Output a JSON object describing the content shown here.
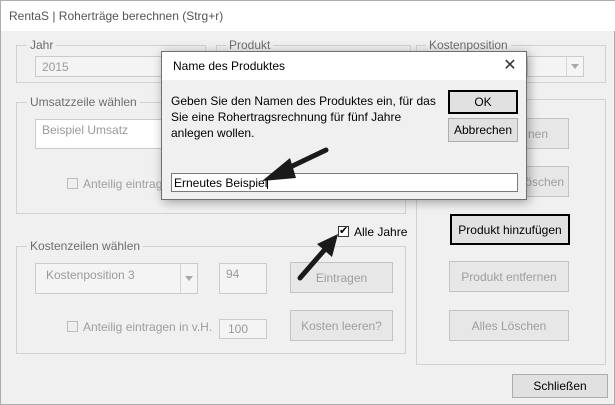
{
  "window": {
    "title": "RentaS | Roherträge berechnen (Strg+r)"
  },
  "jahr": {
    "legend": "Jahr",
    "value": "2015"
  },
  "produkt": {
    "legend": "Produkt"
  },
  "kostenposition": {
    "legend": "Kostenposition"
  },
  "umsatzzeile": {
    "legend": "Umsatzzeile wählen",
    "value": "Beispiel Umsatz",
    "anteilig_label": "Anteilig eintragen"
  },
  "alle_jahre": {
    "label": "Alle Jahre",
    "checked": true
  },
  "kostenzeilen": {
    "legend": "Kostenzeilen wählen",
    "dropdown_value": "Kostenposition 3",
    "amount": "94",
    "eintragen_label": "Eintragen",
    "anteilig_label": "Anteilig eintragen in v.H.",
    "percent": "100",
    "kosten_leeren_label": "Kosten leeren?"
  },
  "right_panel": {
    "btn1_partial": "nen",
    "btn2_partial": "löschen",
    "produkt_hinzufuegen": "Produkt hinzufügen",
    "produkt_entfernen": "Produkt entfernen",
    "alles_loeschen": "Alles Löschen"
  },
  "schliessen_label": "Schließen",
  "dialog": {
    "title": "Name des Produktes",
    "prompt": "Geben Sie den Namen des Produktes ein, für das Sie eine Rohertragsrechnung für fünf Jahre anlegen wollen.",
    "ok_label": "OK",
    "cancel_label": "Abbrechen",
    "input_value": "Erneutes Beispiel",
    "close_glyph": "✕"
  },
  "colors": {
    "arrow": "#1a1a1a",
    "dialog_border": "#707070"
  }
}
